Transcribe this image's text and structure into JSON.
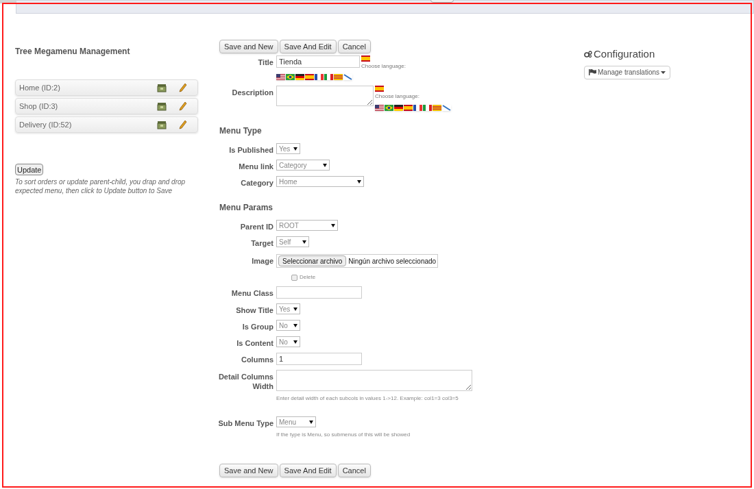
{
  "tree": {
    "title": "Tree Megamenu Management",
    "items": [
      {
        "label": "Home (ID:2)"
      },
      {
        "label": "Shop (ID:3)"
      },
      {
        "label": "Delivery (ID:52)"
      }
    ],
    "update_button": "Update",
    "hint": "To sort orders or update parent-child, you drap and drop expected menu, then click to Update button to Save"
  },
  "form": {
    "buttons_top": [
      "Save and New",
      "Save And Edit",
      "Cancel"
    ],
    "fields": [
      {
        "kind": "translated-text",
        "label": "Title",
        "value": "Tienda",
        "choose_language": "Choose language:"
      },
      {
        "kind": "translated-textarea",
        "label": "Description",
        "choose_language": "Choose language:"
      },
      {
        "kind": "heading",
        "label": "Menu Type"
      },
      {
        "kind": "select",
        "label": "Is Published",
        "value": "Yes"
      },
      {
        "kind": "select",
        "label": "Menu link",
        "value": "Category"
      },
      {
        "kind": "select",
        "label": "Category",
        "value": "Home"
      },
      {
        "kind": "heading",
        "label": "Menu Params"
      },
      {
        "kind": "select",
        "label": "Parent ID",
        "value": "ROOT"
      },
      {
        "kind": "select",
        "label": "Target",
        "value": "Self"
      },
      {
        "kind": "file",
        "label": "Image",
        "button": "Seleccionar archivo",
        "value": "Ningún archivo seleccionado"
      },
      {
        "kind": "checkbox",
        "label": "Delete",
        "checked": false
      },
      {
        "kind": "text",
        "label": "Menu Class"
      },
      {
        "kind": "select",
        "label": "Show Title",
        "value": "Yes"
      },
      {
        "kind": "select",
        "label": "Is Group",
        "value": "No"
      },
      {
        "kind": "select",
        "label": "Is Content",
        "value": "No"
      },
      {
        "kind": "text",
        "label": "Columns",
        "value": "1"
      },
      {
        "kind": "textarea",
        "label": "Detail Columns Width",
        "help": "Enter detail width of each subcols in values 1->12. Example: col1=3 col3=5"
      },
      {
        "kind": "select",
        "label": "Sub Menu Type",
        "value": "Menu",
        "help": "If the type is Menu, so submenus of this will be showed"
      }
    ],
    "buttons_bottom": [
      "Save and New",
      "Save And Edit",
      "Cancel"
    ]
  },
  "config": {
    "title": "Configuration",
    "button": "Manage translations"
  }
}
